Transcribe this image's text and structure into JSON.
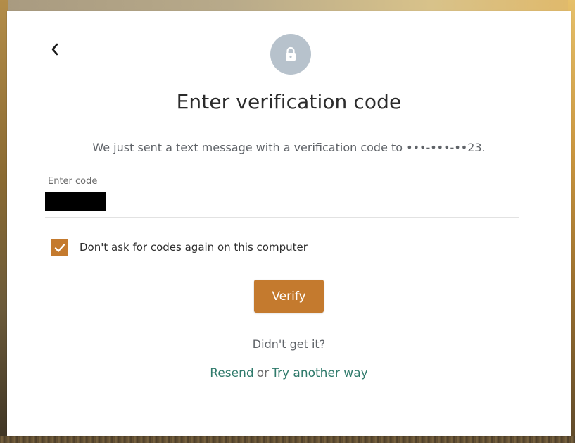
{
  "header": {
    "title": "Enter verification code",
    "subtitle": "We just sent a text message with a verification code to •••-•••-••23."
  },
  "icons": {
    "back": "chevron-left-icon",
    "lock": "lock-icon",
    "check": "checkmark-icon"
  },
  "form": {
    "code_label": "Enter code",
    "code_value": "",
    "remember_label": "Don't ask for codes again on this computer",
    "remember_checked": true,
    "verify_label": "Verify"
  },
  "footer": {
    "didnt_get": "Didn't get it?",
    "resend_label": "Resend",
    "or_text": "or",
    "another_way_label": "Try another way"
  },
  "colors": {
    "accent": "#c47a2e",
    "link": "#2f7a6b",
    "lock_bg": "#b7c2cc"
  }
}
